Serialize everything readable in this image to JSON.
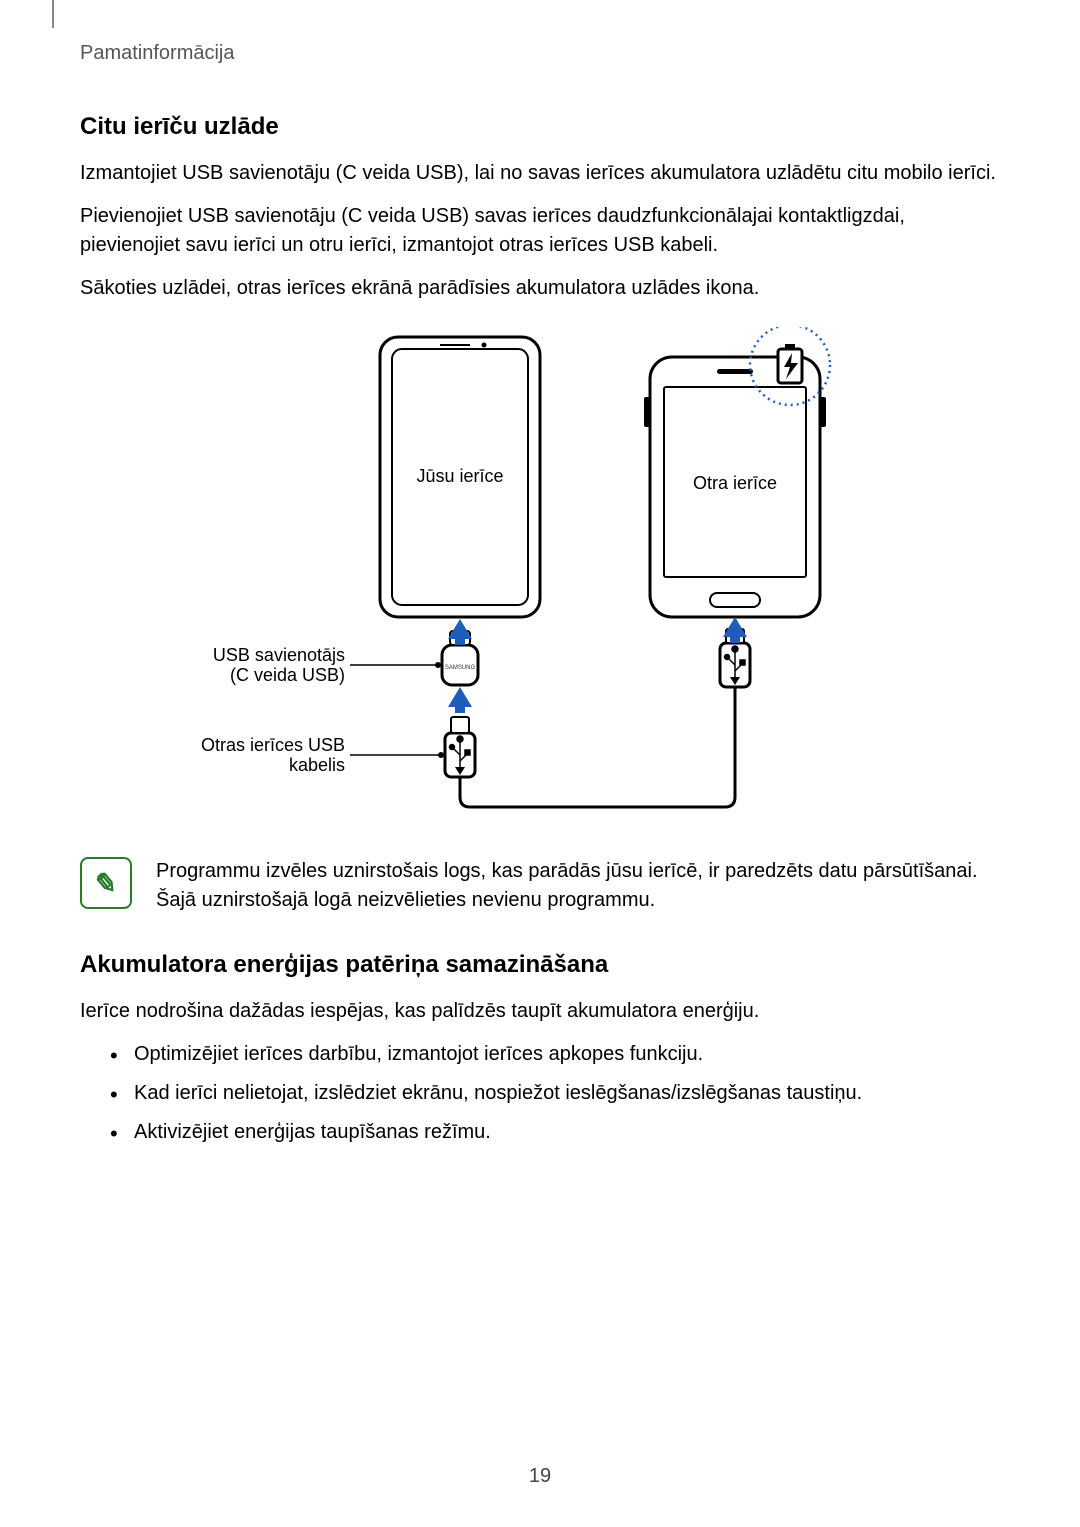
{
  "breadcrumb": "Pamatinformācija",
  "section1": {
    "heading": "Citu ierīču uzlāde",
    "p1": "Izmantojiet USB savienotāju (C veida USB), lai no savas ierīces akumulatora uzlādētu citu mobilo ierīci.",
    "p2": "Pievienojiet USB savienotāju (C veida USB) savas ierīces daudzfunkcionālajai kontaktligzdai, pievienojiet savu ierīci un otru ierīci, izmantojot otras ierīces USB kabeli.",
    "p3": "Sākoties uzlādei, otras ierīces ekrānā parādīsies akumulatora uzlādes ikona."
  },
  "diagram": {
    "your_device": "Jūsu ierīce",
    "other_device": "Otra ierīce",
    "usb_connector_l1": "USB savienotājs",
    "usb_connector_l2": "(C veida USB)",
    "usb_cable_l1": "Otras ierīces USB",
    "usb_cable_l2": "kabelis"
  },
  "note": {
    "text": "Programmu izvēles uznirstošais logs, kas parādās jūsu ierīcē, ir paredzēts datu pārsūtīšanai. Šajā uznirstošajā logā neizvēlieties nevienu programmu."
  },
  "section2": {
    "heading": "Akumulatora enerģijas patēriņa samazināšana",
    "p1": "Ierīce nodrošina dažādas iespējas, kas palīdzēs taupīt akumulatora enerģiju.",
    "bullets": [
      "Optimizējiet ierīces darbību, izmantojot ierīces apkopes funkciju.",
      "Kad ierīci nelietojat, izslēdziet ekrānu, nospiežot ieslēgšanas/izslēgšanas taustiņu.",
      "Aktivizējiet enerģijas taupīšanas režīmu."
    ]
  },
  "page_number": "19"
}
